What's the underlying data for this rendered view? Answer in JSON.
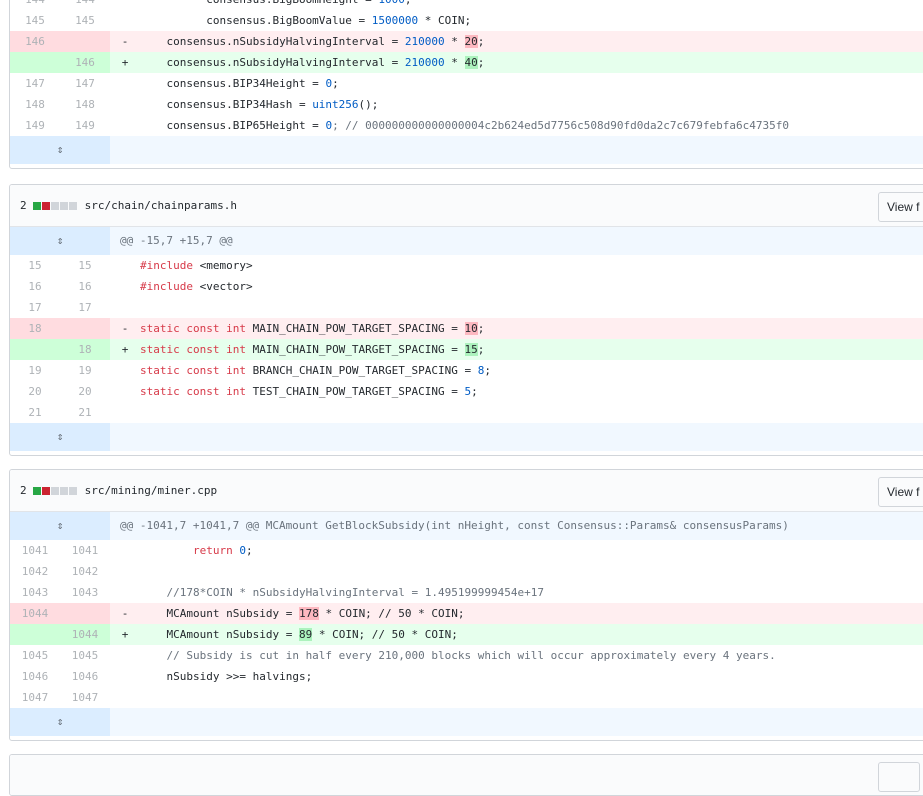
{
  "expand_glyph": "⇕",
  "file1": {
    "lines": [
      {
        "old": "144",
        "new": "144",
        "type": "ctx",
        "parts": [
          [
            "          consensus.BigBoomHeight = ",
            ""
          ],
          [
            "1000",
            "n"
          ],
          [
            ";",
            ""
          ]
        ]
      },
      {
        "old": "145",
        "new": "145",
        "type": "ctx",
        "parts": [
          [
            "          consensus.BigBoomValue = ",
            ""
          ],
          [
            "1500000",
            "n"
          ],
          [
            " * COIN;",
            ""
          ]
        ]
      },
      {
        "old": "146",
        "new": "",
        "type": "del",
        "sign": "-",
        "parts": [
          [
            "    consensus.nSubsidyHalvingInterval = ",
            ""
          ],
          [
            "210000",
            "n"
          ],
          [
            " * ",
            ""
          ],
          [
            "20",
            "hd"
          ],
          [
            ";",
            ""
          ]
        ]
      },
      {
        "old": "",
        "new": "146",
        "type": "add",
        "sign": "+",
        "parts": [
          [
            "    consensus.nSubsidyHalvingInterval = ",
            ""
          ],
          [
            "210000",
            "n"
          ],
          [
            " * ",
            ""
          ],
          [
            "40",
            "ha"
          ],
          [
            ";",
            ""
          ]
        ]
      },
      {
        "old": "147",
        "new": "147",
        "type": "ctx",
        "parts": [
          [
            "    consensus.BIP34Height = ",
            ""
          ],
          [
            "0",
            "n"
          ],
          [
            ";",
            ""
          ]
        ]
      },
      {
        "old": "148",
        "new": "148",
        "type": "ctx",
        "parts": [
          [
            "    consensus.BIP34Hash = ",
            ""
          ],
          [
            "uint256",
            "n"
          ],
          [
            "();",
            ""
          ]
        ]
      },
      {
        "old": "149",
        "new": "149",
        "type": "ctx",
        "parts": [
          [
            "    consensus.BIP65Height = ",
            ""
          ],
          [
            "0",
            "n"
          ],
          [
            "; // 000000000000000004c2b624ed5d7756c508d90fd0da2c7c679febfa6c4735f0",
            "c"
          ]
        ]
      }
    ]
  },
  "file2": {
    "count": "2",
    "path": "src/chain/chainparams.h",
    "view_label": "View f",
    "hunk": "@@ -15,7 +15,7 @@",
    "lines": [
      {
        "old": "15",
        "new": "15",
        "type": "ctx",
        "parts": [
          [
            "#include ",
            "k"
          ],
          [
            "<memory>",
            ""
          ]
        ]
      },
      {
        "old": "16",
        "new": "16",
        "type": "ctx",
        "parts": [
          [
            "#include ",
            "k"
          ],
          [
            "<vector>",
            ""
          ]
        ]
      },
      {
        "old": "17",
        "new": "17",
        "type": "ctx",
        "parts": [
          [
            "",
            ""
          ]
        ]
      },
      {
        "old": "18",
        "new": "",
        "type": "del",
        "sign": "-",
        "parts": [
          [
            "static const int ",
            "k"
          ],
          [
            "MAIN_CHAIN_POW_TARGET_SPACING = ",
            ""
          ],
          [
            "10",
            "hd"
          ],
          [
            ";",
            ""
          ]
        ]
      },
      {
        "old": "",
        "new": "18",
        "type": "add",
        "sign": "+",
        "parts": [
          [
            "static const int ",
            "k"
          ],
          [
            "MAIN_CHAIN_POW_TARGET_SPACING = ",
            ""
          ],
          [
            "15",
            "ha"
          ],
          [
            ";",
            ""
          ]
        ]
      },
      {
        "old": "19",
        "new": "19",
        "type": "ctx",
        "parts": [
          [
            "static const int ",
            "k"
          ],
          [
            "BRANCH_CHAIN_POW_TARGET_SPACING = ",
            ""
          ],
          [
            "8",
            "n"
          ],
          [
            ";",
            ""
          ]
        ]
      },
      {
        "old": "20",
        "new": "20",
        "type": "ctx",
        "parts": [
          [
            "static const int ",
            "k"
          ],
          [
            "TEST_CHAIN_POW_TARGET_SPACING = ",
            ""
          ],
          [
            "5",
            "n"
          ],
          [
            ";",
            ""
          ]
        ]
      },
      {
        "old": "21",
        "new": "21",
        "type": "ctx",
        "parts": [
          [
            "",
            ""
          ]
        ]
      }
    ]
  },
  "file3": {
    "count": "2",
    "path": "src/mining/miner.cpp",
    "view_label": "View f",
    "hunk": "@@ -1041,7 +1041,7 @@ MCAmount GetBlockSubsidy(int nHeight, const Consensus::Params& consensusParams)",
    "lines": [
      {
        "old": "1041",
        "new": "1041",
        "type": "ctx",
        "parts": [
          [
            "        ",
            ""
          ],
          [
            "return ",
            "k"
          ],
          [
            "0",
            "n"
          ],
          [
            ";",
            ""
          ]
        ]
      },
      {
        "old": "1042",
        "new": "1042",
        "type": "ctx",
        "parts": [
          [
            "",
            ""
          ]
        ]
      },
      {
        "old": "1043",
        "new": "1043",
        "type": "ctx",
        "parts": [
          [
            "    //178*COIN * nSubsidyHalvingInterval = 1.495199999454e+17",
            "c"
          ]
        ]
      },
      {
        "old": "1044",
        "new": "",
        "type": "del",
        "sign": "-",
        "parts": [
          [
            "    MCAmount nSubsidy = ",
            ""
          ],
          [
            "178",
            "hd"
          ],
          [
            " * COIN; // 50 * COIN;",
            ""
          ]
        ]
      },
      {
        "old": "",
        "new": "1044",
        "type": "add",
        "sign": "+",
        "parts": [
          [
            "    MCAmount nSubsidy = ",
            ""
          ],
          [
            "89",
            "ha"
          ],
          [
            " * COIN; // 50 * COIN;",
            ""
          ]
        ]
      },
      {
        "old": "1045",
        "new": "1045",
        "type": "ctx",
        "parts": [
          [
            "    // Subsidy is cut in half every 210,000 blocks which will occur approximately every 4 years.",
            "c"
          ]
        ]
      },
      {
        "old": "1046",
        "new": "1046",
        "type": "ctx",
        "parts": [
          [
            "    nSubsidy >>= halvings;",
            ""
          ]
        ]
      },
      {
        "old": "1047",
        "new": "1047",
        "type": "ctx",
        "parts": [
          [
            "",
            ""
          ]
        ]
      }
    ]
  }
}
